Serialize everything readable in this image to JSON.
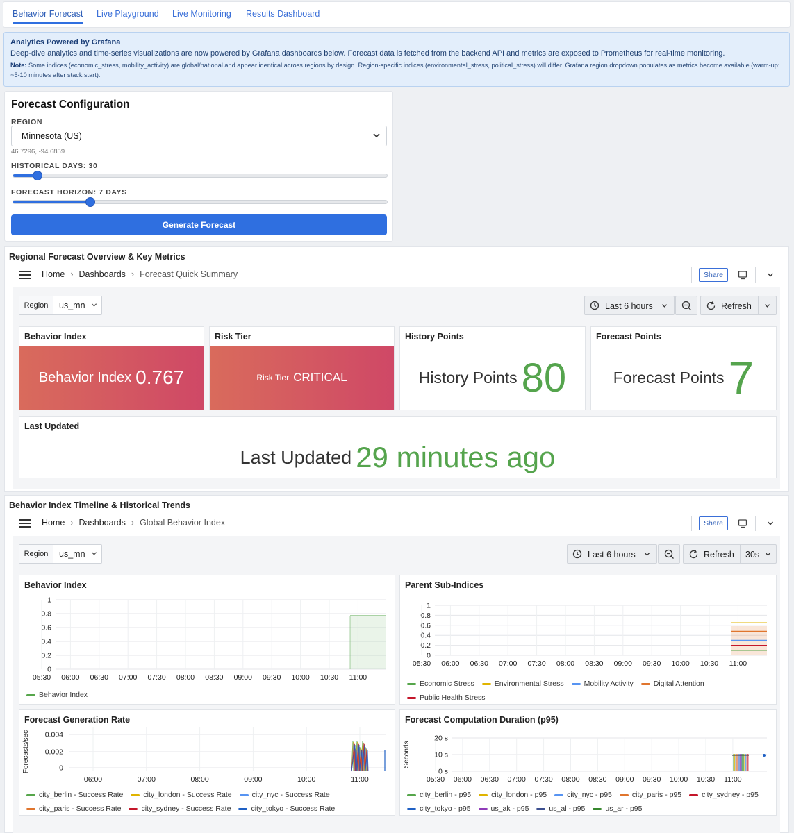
{
  "tabs": [
    "Behavior Forecast",
    "Live Playground",
    "Live Monitoring",
    "Results Dashboard"
  ],
  "banner": {
    "title": "Analytics Powered by Grafana",
    "text": "Deep-dive analytics and time-series visualizations are now powered by Grafana dashboards below. Forecast data is fetched from the backend API and metrics are exposed to Prometheus for real-time monitoring.",
    "note_label": "Note:",
    "note": " Some indices (economic_stress, mobility_activity) are global/national and appear identical across regions by design. Region-specific indices (environmental_stress, political_stress) will differ. Grafana region dropdown populates as metrics become available (warm-up: ~5-10 minutes after stack start)."
  },
  "config": {
    "title": "Forecast Configuration",
    "region_label": "REGION",
    "region_value": "Minnesota (US)",
    "coords": "46.7296, -94.6859",
    "hist_label": "HISTORICAL DAYS: 30",
    "hist_value": 30,
    "hist_min": 7,
    "hist_max": 365,
    "horizon_label": "FORECAST HORIZON: 7 DAYS",
    "horizon_value": 7,
    "horizon_min": 1,
    "horizon_max": 30,
    "button": "Generate Forecast"
  },
  "summary": {
    "section_title": "Regional Forecast Overview & Key Metrics",
    "crumbs": [
      "Home",
      "Dashboards",
      "Forecast Quick Summary"
    ],
    "share": "Share",
    "region_key": "Region",
    "region_val": "us_mn",
    "time_range": "Last 6 hours",
    "refresh": "Refresh",
    "behavior_title": "Behavior Index",
    "behavior_label": "Behavior Index",
    "behavior_value": "0.767",
    "risk_title": "Risk Tier",
    "risk_label": "Risk Tier",
    "risk_value": "CRITICAL",
    "history_title": "History Points",
    "history_label": "History Points",
    "history_value": "80",
    "forecast_title": "Forecast Points",
    "forecast_label": "Forecast Points",
    "forecast_value": "7",
    "updated_title": "Last Updated",
    "updated_label": "Last Updated",
    "updated_value": "29 minutes ago"
  },
  "timeline": {
    "section_title": "Behavior Index Timeline & Historical Trends",
    "crumbs": [
      "Home",
      "Dashboards",
      "Global Behavior Index"
    ],
    "share": "Share",
    "region_key": "Region",
    "region_val": "us_mn",
    "time_range": "Last 6 hours",
    "refresh": "Refresh",
    "interval": "30s",
    "p1_title": "Behavior Index",
    "p2_title": "Parent Sub-Indices",
    "p3_title": "Forecast Generation Rate",
    "p3_ylabel": "Forecasts/sec",
    "p4_title": "Forecast Computation Duration (p95)",
    "p4_ylabel": "Seconds"
  },
  "colors": {
    "green": "#56a64b",
    "yellow": "#e0b400",
    "blue": "#5794f2",
    "orange": "#e0752d",
    "red": "#c4162a",
    "purple": "#8f3bb8",
    "darkblue": "#1f60c4",
    "darkgreen": "#37872d",
    "accent": "#2f6fe0"
  },
  "chart_data": [
    {
      "type": "line",
      "title": "Behavior Index",
      "x": [
        "05:30",
        "06:00",
        "06:30",
        "07:00",
        "07:30",
        "08:00",
        "08:30",
        "09:00",
        "09:30",
        "10:00",
        "10:30",
        "11:00"
      ],
      "yticks": [
        "0",
        "0.2",
        "0.4",
        "0.6",
        "0.8",
        "1"
      ],
      "ylim": [
        0,
        1
      ],
      "series": [
        {
          "name": "Behavior Index",
          "color": "#56a64b",
          "value": 0.767
        }
      ]
    },
    {
      "type": "line",
      "title": "Parent Sub-Indices",
      "x": [
        "05:30",
        "06:00",
        "06:30",
        "07:00",
        "07:30",
        "08:00",
        "08:30",
        "09:00",
        "09:30",
        "10:00",
        "10:30",
        "11:00"
      ],
      "yticks": [
        "0",
        "0.2",
        "0.4",
        "0.6",
        "0.8",
        "1"
      ],
      "ylim": [
        0,
        1
      ],
      "series": [
        {
          "name": "Economic Stress",
          "color": "#56a64b",
          "value": 0.1
        },
        {
          "name": "Environmental Stress",
          "color": "#e0b400",
          "value": 0.65
        },
        {
          "name": "Mobility Activity",
          "color": "#5794f2",
          "value": 0.3
        },
        {
          "name": "Digital Attention",
          "color": "#e0752d",
          "value": 0.48
        },
        {
          "name": "Public Health Stress",
          "color": "#c4162a",
          "value": 0.2
        }
      ]
    },
    {
      "type": "line",
      "title": "Forecast Generation Rate",
      "x": [
        "06:00",
        "07:00",
        "08:00",
        "09:00",
        "10:00",
        "11:00"
      ],
      "yticks": [
        "0",
        "0.002",
        "0.004"
      ],
      "ylabel": "Forecasts/sec",
      "series": [
        {
          "name": "city_berlin - Success Rate",
          "color": "#56a64b"
        },
        {
          "name": "city_london - Success Rate",
          "color": "#e0b400"
        },
        {
          "name": "city_nyc - Success Rate",
          "color": "#5794f2"
        },
        {
          "name": "city_paris - Success Rate",
          "color": "#e0752d"
        },
        {
          "name": "city_sydney - Success Rate",
          "color": "#c4162a"
        },
        {
          "name": "city_tokyo - Success Rate",
          "color": "#1f60c4"
        }
      ]
    },
    {
      "type": "line",
      "title": "Forecast Computation Duration (p95)",
      "x": [
        "05:30",
        "06:00",
        "06:30",
        "07:00",
        "07:30",
        "08:00",
        "08:30",
        "09:00",
        "09:30",
        "10:00",
        "10:30",
        "11:00"
      ],
      "yticks": [
        "0 s",
        "10 s",
        "20 s"
      ],
      "ylabel": "Seconds",
      "series": [
        {
          "name": "city_berlin - p95",
          "color": "#56a64b"
        },
        {
          "name": "city_london - p95",
          "color": "#e0b400"
        },
        {
          "name": "city_nyc - p95",
          "color": "#5794f2"
        },
        {
          "name": "city_paris - p95",
          "color": "#e0752d"
        },
        {
          "name": "city_sydney - p95",
          "color": "#c4162a"
        },
        {
          "name": "city_tokyo - p95",
          "color": "#1f60c4"
        },
        {
          "name": "us_ak - p95",
          "color": "#8f3bb8"
        },
        {
          "name": "us_al - p95",
          "color": "#3c4f8f"
        },
        {
          "name": "us_ar - p95",
          "color": "#37872d"
        }
      ]
    }
  ]
}
